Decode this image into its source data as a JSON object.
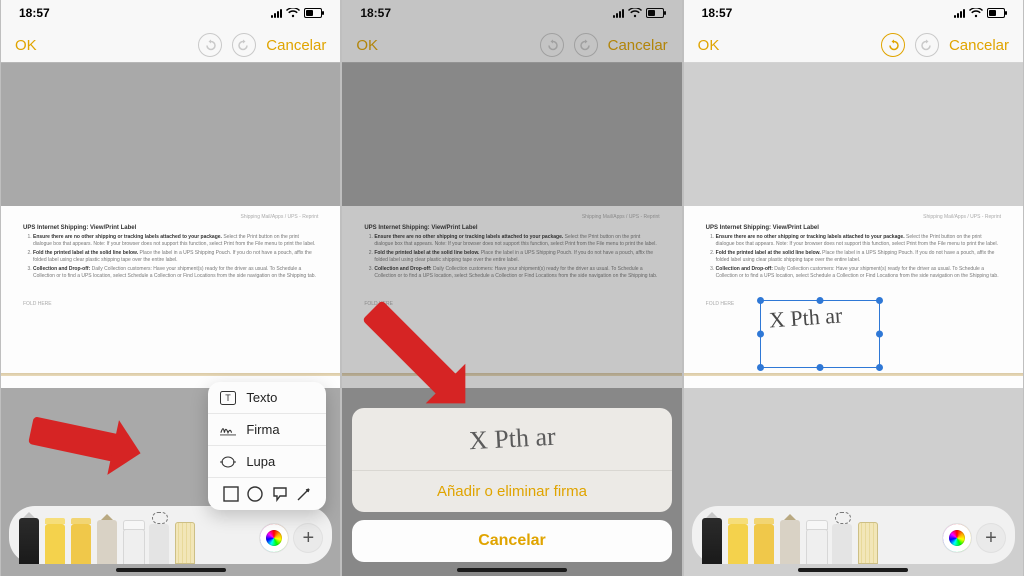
{
  "status": {
    "time": "18:57"
  },
  "nav": {
    "ok": "OK",
    "cancel": "Cancelar"
  },
  "popover": {
    "text": "Texto",
    "sign": "Firma",
    "loupe": "Lupa"
  },
  "sheet": {
    "manage": "Añadir o eliminar firma",
    "cancel": "Cancelar",
    "signature_sample": "X Pth ar"
  },
  "placed_signature": "X Pth ar",
  "doc": {
    "subtitle": "Shipping Mail/Apps / UPS - Reprint",
    "heading": "UPS Internet Shipping: View/Print Label",
    "fold": "FOLD HERE",
    "items": [
      {
        "b": "Ensure there are no other shipping or tracking labels attached to your package.",
        "rest": "Select the Print button on the print dialogue box that appears. Note: If your browser does not support this function, select Print from the File menu to print the label."
      },
      {
        "b": "Fold the printed label at the solid line below.",
        "rest": "Place the label in a UPS Shipping Pouch. If you do not have a pouch, affix the folded label using clear plastic shipping tape over the entire label."
      },
      {
        "b": "Collection and Drop-off:",
        "rest": "Daily Collection customers: Have your shipment(s) ready for the driver as usual. To Schedule a Collection or to find a UPS location, select Schedule a Collection or Find Locations from the side navigation on the Shipping tab."
      }
    ]
  }
}
